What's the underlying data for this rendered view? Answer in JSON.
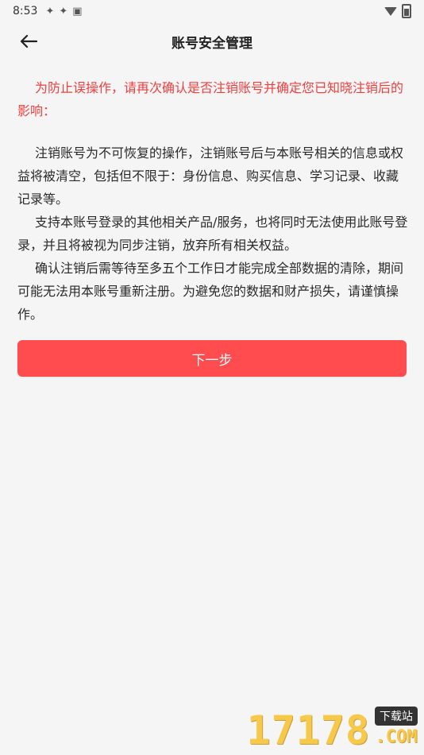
{
  "status_bar": {
    "time": "8:53",
    "icons": [
      "gear-icon",
      "gear-icon",
      "a-badge-icon"
    ]
  },
  "header": {
    "title": "账号安全管理",
    "back_icon": "arrow-left-icon"
  },
  "warning": {
    "text": "为防止误操作，请再次确认是否注销账号并确定您已知晓注销后的影响："
  },
  "paragraphs": [
    "注销账号为不可恢复的操作，注销账号后与本账号相关的信息或权益将被清空，包括但不限于：身份信息、购买信息、学习记录、收藏记录等。",
    "支持本账号登录的其他相关产品/服务，也将同时无法使用此账号登录，并且将被视为同步注销，放弃所有相关权益。",
    "确认注销后需等待至多五个工作日才能完成全部数据的清除，期间可能无法用本账号重新注册。为避免您的数据和财产损失，请谨慎操作。"
  ],
  "next_button": {
    "label": "下一步"
  },
  "watermark": {
    "digits": "17178",
    "tag": "下载站",
    "suffix": ".COM"
  },
  "colors": {
    "accent_red": "#ff4d4f",
    "warning_text": "#ef3f3f",
    "background": "#f5f5f5"
  }
}
